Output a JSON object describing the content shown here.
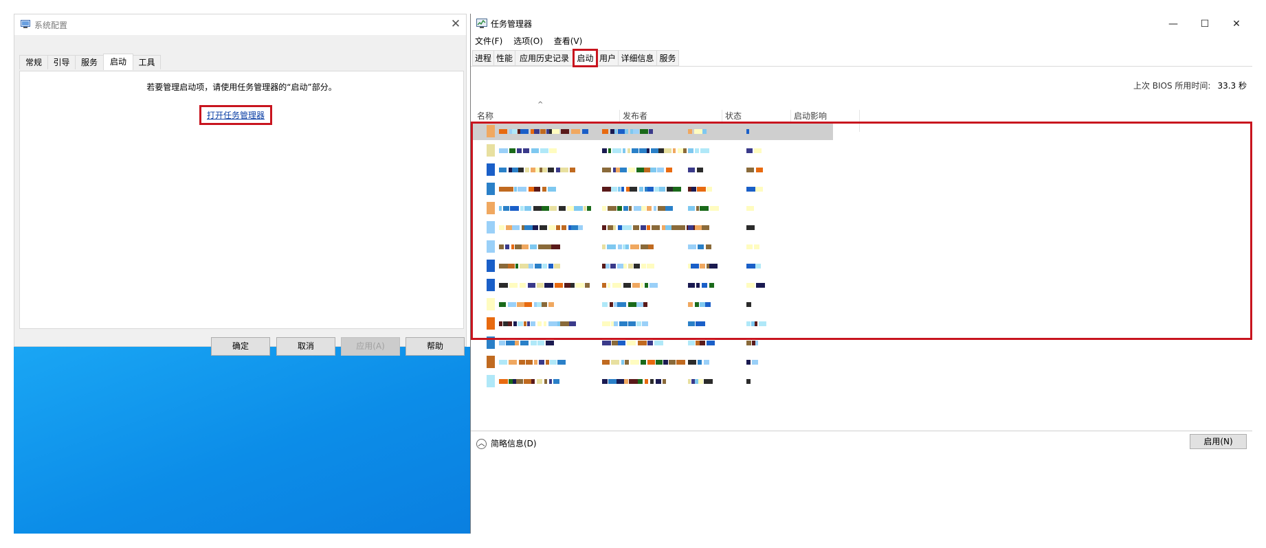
{
  "msconfig": {
    "title": "系统配置",
    "tabs": [
      "常规",
      "引导",
      "服务",
      "启动",
      "工具"
    ],
    "active_tab": "启动",
    "info_text": "若要管理启动项，请使用任务管理器的“启动”部分。",
    "open_taskmgr_link": "打开任务管理器",
    "buttons": {
      "ok": "确定",
      "cancel": "取消",
      "apply": "应用(A)",
      "help": "帮助"
    }
  },
  "taskmgr": {
    "title": "任务管理器",
    "menu": [
      "文件(F)",
      "选项(O)",
      "查看(V)"
    ],
    "tabs": [
      "进程",
      "性能",
      "应用历史记录",
      "启动",
      "用户",
      "详细信息",
      "服务"
    ],
    "active_tab": "启动",
    "bios_label": "上次 BIOS 所用时间:",
    "bios_value": "33.3 秒",
    "columns": {
      "name": "名称",
      "publisher": "发布者",
      "status": "状态",
      "impact": "启动影响"
    },
    "sort_indicator": "^",
    "startup_rows_count": 14,
    "fewer_details": "简略信息(D)",
    "enable_button": "启用(N)",
    "window_controls": {
      "minimize": "—",
      "maximize": "☐",
      "close": "✕"
    }
  },
  "colors": {
    "highlight_box": "#c8141e",
    "desktop_blue": "#0c8de8",
    "link_blue": "#0b3fa5"
  }
}
